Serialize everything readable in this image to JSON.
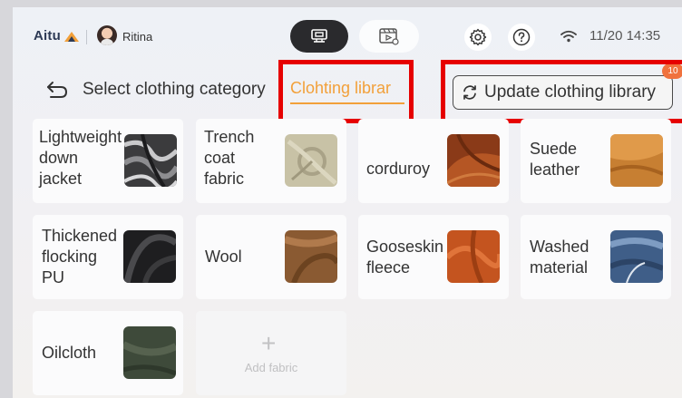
{
  "header": {
    "brand": "Aitu",
    "user_name": "Ritina",
    "datetime": "11/20 14:35",
    "icons": [
      "workstation-icon",
      "video-icon",
      "gear-icon",
      "help-icon",
      "wifi-icon"
    ]
  },
  "nav": {
    "title": "Select clothing category",
    "active_tab": "Clohting librar",
    "update_button": "Update clothing library",
    "update_badge": "10"
  },
  "fabrics": [
    {
      "label": "Lightweight\ndown\njacket",
      "swatch": "silver-quilted"
    },
    {
      "label": "Trench\ncoat\nfabric",
      "swatch": "beige-twill"
    },
    {
      "label": "corduroy",
      "swatch": "rust-corduroy"
    },
    {
      "label": "Suede\nleather",
      "swatch": "tan-suede"
    },
    {
      "label": "Thickened\nflocking\nPU",
      "swatch": "black-pu"
    },
    {
      "label": "Wool",
      "swatch": "brown-wool"
    },
    {
      "label": "Gooseskin\nfleece",
      "swatch": "orange-fleece"
    },
    {
      "label": "Washed\nmaterial",
      "swatch": "blue-denim"
    },
    {
      "label": "Oilcloth",
      "swatch": "olive-oilcloth"
    }
  ],
  "add_fabric": {
    "label": "Add fabric"
  },
  "colors": {
    "accent": "#f2a03a",
    "highlight": "#e60000",
    "badge": "#f0723e"
  }
}
